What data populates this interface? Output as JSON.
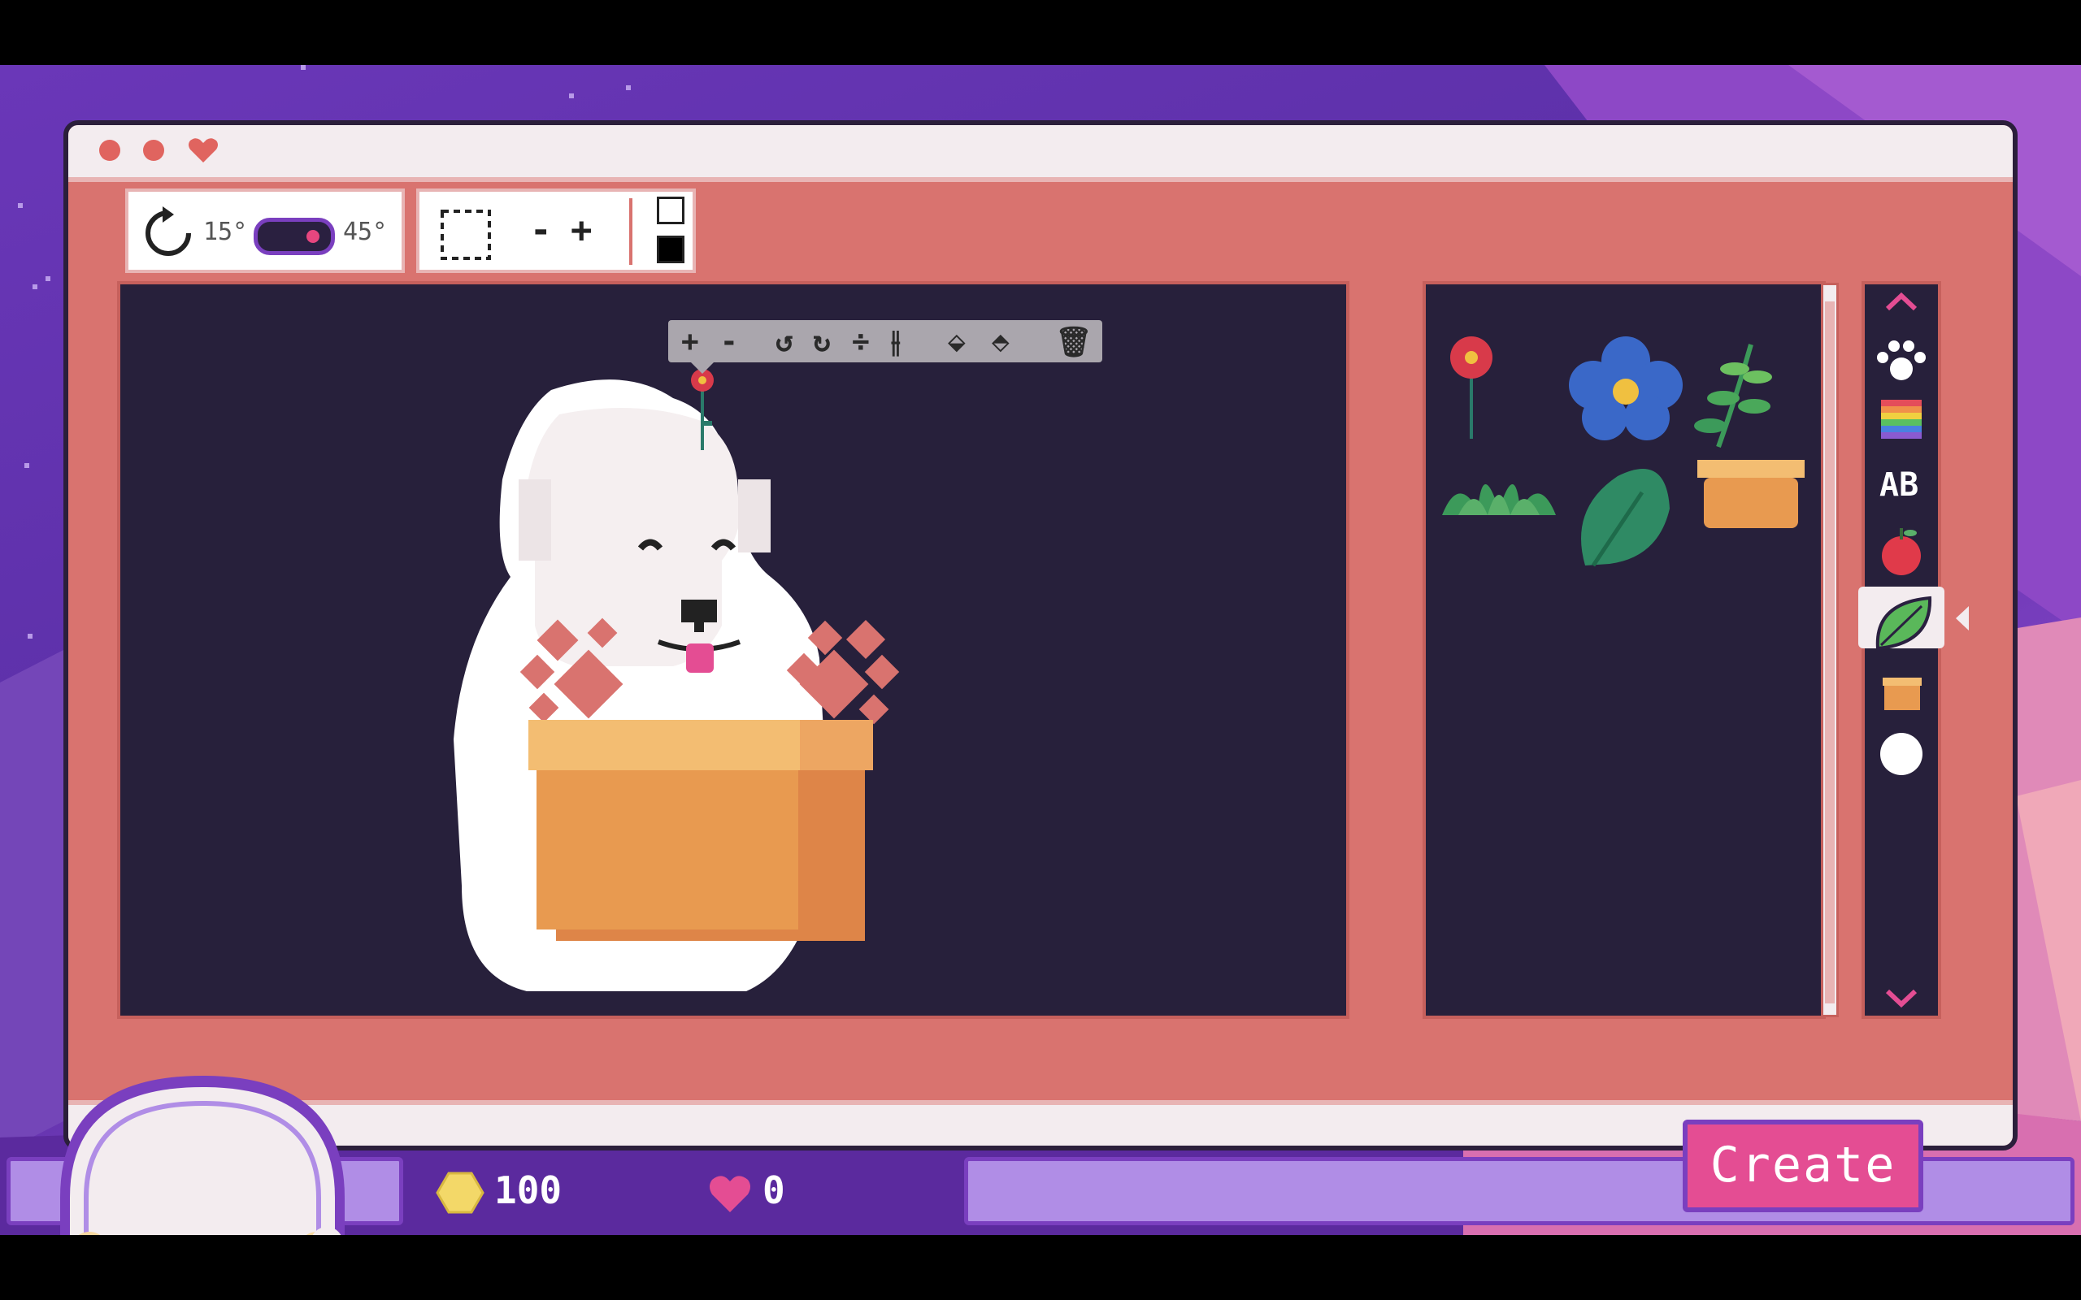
{
  "window": {
    "title_dots": [
      "close",
      "minimize"
    ],
    "favorite": "heart-icon"
  },
  "rotation": {
    "small_step": "15°",
    "large_step": "45°",
    "toggle_on": true
  },
  "edit_toolbar": {
    "minus": "-",
    "plus": "+"
  },
  "floating_toolbar": {
    "plus": "+",
    "minus": "-"
  },
  "stickers": [
    {
      "name": "red-flower-sticker"
    },
    {
      "name": "blue-flower-sticker"
    },
    {
      "name": "fern-sticker"
    },
    {
      "name": "grass-sticker"
    },
    {
      "name": "monstera-leaf-sticker"
    },
    {
      "name": "plant-pot-sticker"
    }
  ],
  "categories": [
    {
      "name": "paw-icon"
    },
    {
      "name": "rainbow-icon"
    },
    {
      "name": "text-icon",
      "label": "AB"
    },
    {
      "name": "apple-icon"
    },
    {
      "name": "leaf-icon",
      "active": true
    },
    {
      "name": "box-icon"
    },
    {
      "name": "circle-icon"
    }
  ],
  "hud": {
    "coins": "100",
    "hearts": "0",
    "create_label": "Create"
  },
  "colors": {
    "window": "#d9736f",
    "canvas": "#27203b",
    "accent": "#e44d93",
    "hud": "#b08de6"
  }
}
